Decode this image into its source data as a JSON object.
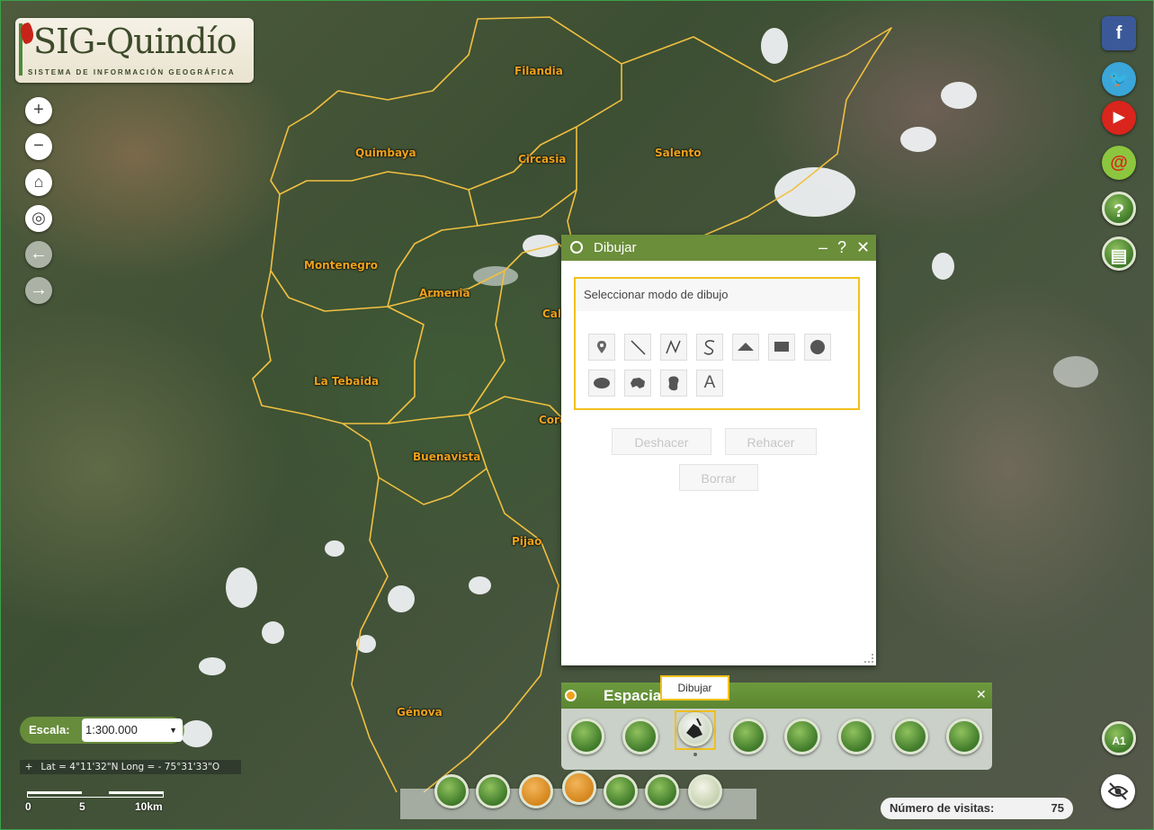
{
  "logo": {
    "main": "SIG-Quindío",
    "sub": "SISTEMA DE INFORMACIÓN GEOGRÁFICA"
  },
  "map_controls": [
    {
      "name": "zoom-in-button",
      "glyph": "+"
    },
    {
      "name": "zoom-out-button",
      "glyph": "−"
    },
    {
      "name": "home-button",
      "glyph": "⌂"
    },
    {
      "name": "locate-button",
      "glyph": "◎"
    },
    {
      "name": "back-button",
      "glyph": "←"
    },
    {
      "name": "forward-button",
      "glyph": "→"
    }
  ],
  "municipalities": [
    "Filandia",
    "Quimbaya",
    "Circasia",
    "Salento",
    "Montenegro",
    "Armenia",
    "Cala",
    "La Tebaida",
    "Cord",
    "Buenavista",
    "Pijao",
    "Génova"
  ],
  "social": [
    {
      "icon": "facebook-icon",
      "glyph": "f",
      "color": "#3b5998"
    },
    {
      "icon": "twitter-icon",
      "glyph": "🐦",
      "color": "#3aa6d9"
    },
    {
      "icon": "youtube-icon",
      "glyph": "▶",
      "color": "#d9251c"
    },
    {
      "icon": "email-icon",
      "glyph": "@",
      "color": "#8cc63f"
    },
    {
      "icon": "help-icon",
      "glyph": "?",
      "color": "#4c8a2a"
    },
    {
      "icon": "calculator-icon",
      "glyph": "▤",
      "color": "#4c8a2a"
    }
  ],
  "draw_panel": {
    "title": "Dibujar",
    "minimize": "–",
    "help": "?",
    "close": "✕",
    "mode_label": "Seleccionar modo de dibujo",
    "tools": [
      "point",
      "line",
      "polyline",
      "freehand-polyline",
      "triangle",
      "rectangle",
      "circle",
      "ellipse",
      "polygon",
      "freehand-polygon",
      "text"
    ],
    "text_tool_glyph": "A",
    "undo": "Deshacer",
    "redo": "Rehacer",
    "clear": "Borrar"
  },
  "spatial_panel": {
    "title": "Espaciales",
    "close": "✕",
    "tooltip": "Dibujar",
    "tool_count": 8
  },
  "scale": {
    "label": "Escala:",
    "value": "1:300.000"
  },
  "coordinates": "Lat = 4°11'32\"N Long = - 75°31'33\"O",
  "scalebar": {
    "ticks": [
      "0",
      "5",
      "10km"
    ]
  },
  "visits": {
    "label": "Número de visitas:",
    "value": "75"
  },
  "overview_label": "A1",
  "colors": {
    "panel_header": "#6b8e3a",
    "highlight": "#f2c01c",
    "municipal_label": "#f0a21c",
    "boundary": "#f0c040"
  }
}
